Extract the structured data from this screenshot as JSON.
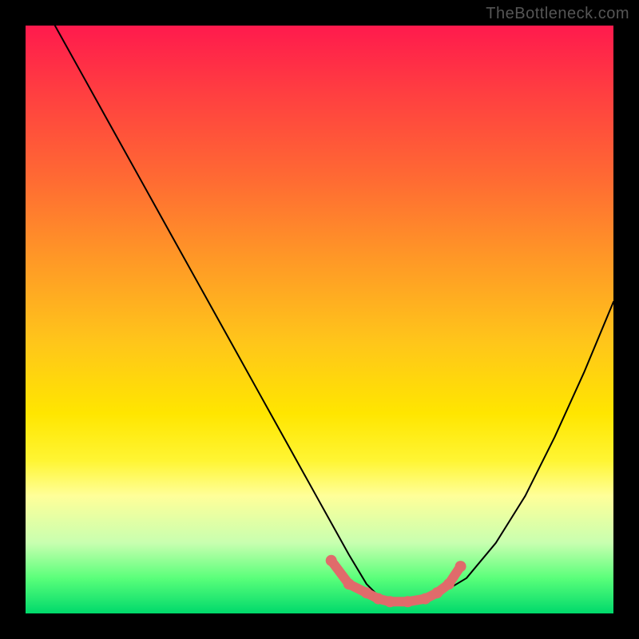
{
  "watermark": "TheBottleneck.com",
  "chart_data": {
    "type": "line",
    "title": "",
    "xlabel": "",
    "ylabel": "",
    "xlim": [
      0,
      100
    ],
    "ylim": [
      0,
      100
    ],
    "series": [
      {
        "name": "bottleneck-curve",
        "x": [
          5,
          10,
          15,
          20,
          25,
          30,
          35,
          40,
          45,
          50,
          55,
          58,
          60,
          62,
          65,
          68,
          70,
          75,
          80,
          85,
          90,
          95,
          100
        ],
        "y": [
          100,
          91,
          82,
          73,
          64,
          55,
          46,
          37,
          28,
          19,
          10,
          5,
          3,
          2,
          2,
          2,
          3,
          6,
          12,
          20,
          30,
          41,
          53
        ]
      },
      {
        "name": "highlight-band",
        "x": [
          52,
          55,
          58,
          60,
          62,
          65,
          68,
          70,
          72,
          74
        ],
        "y": [
          9,
          5,
          3.5,
          2.5,
          2,
          2,
          2.5,
          3.5,
          5,
          8
        ]
      }
    ],
    "colors": {
      "curve": "#000000",
      "highlight": "#e06b6b",
      "gradient_top": "#ff1a4d",
      "gradient_bottom": "#00d96b"
    }
  }
}
